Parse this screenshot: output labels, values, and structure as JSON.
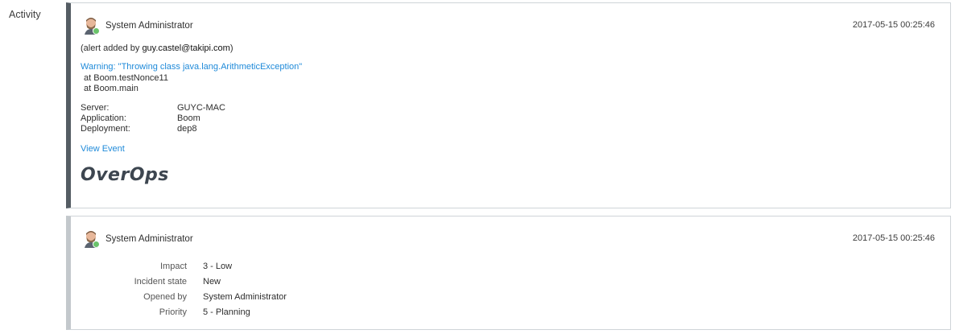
{
  "activity_label": "Activity",
  "entries": [
    {
      "author": "System Administrator",
      "timestamp": "2017-05-15 00:25:46",
      "alert_prefix": "(alert added by ",
      "alert_user": "guy.castel@takipi.com",
      "alert_suffix": ")",
      "warning": "Warning: \"Throwing class java.lang.ArithmeticException\"",
      "stack": [
        "at Boom.testNonce11",
        "at Boom.main"
      ],
      "fields": [
        {
          "key": "Server:",
          "value": "GUYC-MAC"
        },
        {
          "key": "Application:",
          "value": "Boom"
        },
        {
          "key": "Deployment:",
          "value": "dep8"
        }
      ],
      "view_event": "View Event",
      "logo_text": "OverOps"
    },
    {
      "author": "System Administrator",
      "timestamp": "2017-05-15 00:25:46",
      "fields": [
        {
          "key": "Impact",
          "value": "3 - Low"
        },
        {
          "key": "Incident state",
          "value": "New"
        },
        {
          "key": "Opened by",
          "value": "System Administrator"
        },
        {
          "key": "Priority",
          "value": "5 - Planning"
        }
      ]
    }
  ],
  "colors": {
    "link": "#1f8ad9",
    "card1_accent": "#555d64",
    "card2_accent": "#c3c8cc",
    "status_online": "#6ac36a"
  },
  "icons": {
    "avatar": "user-avatar-icon",
    "status": "online-status-icon"
  }
}
